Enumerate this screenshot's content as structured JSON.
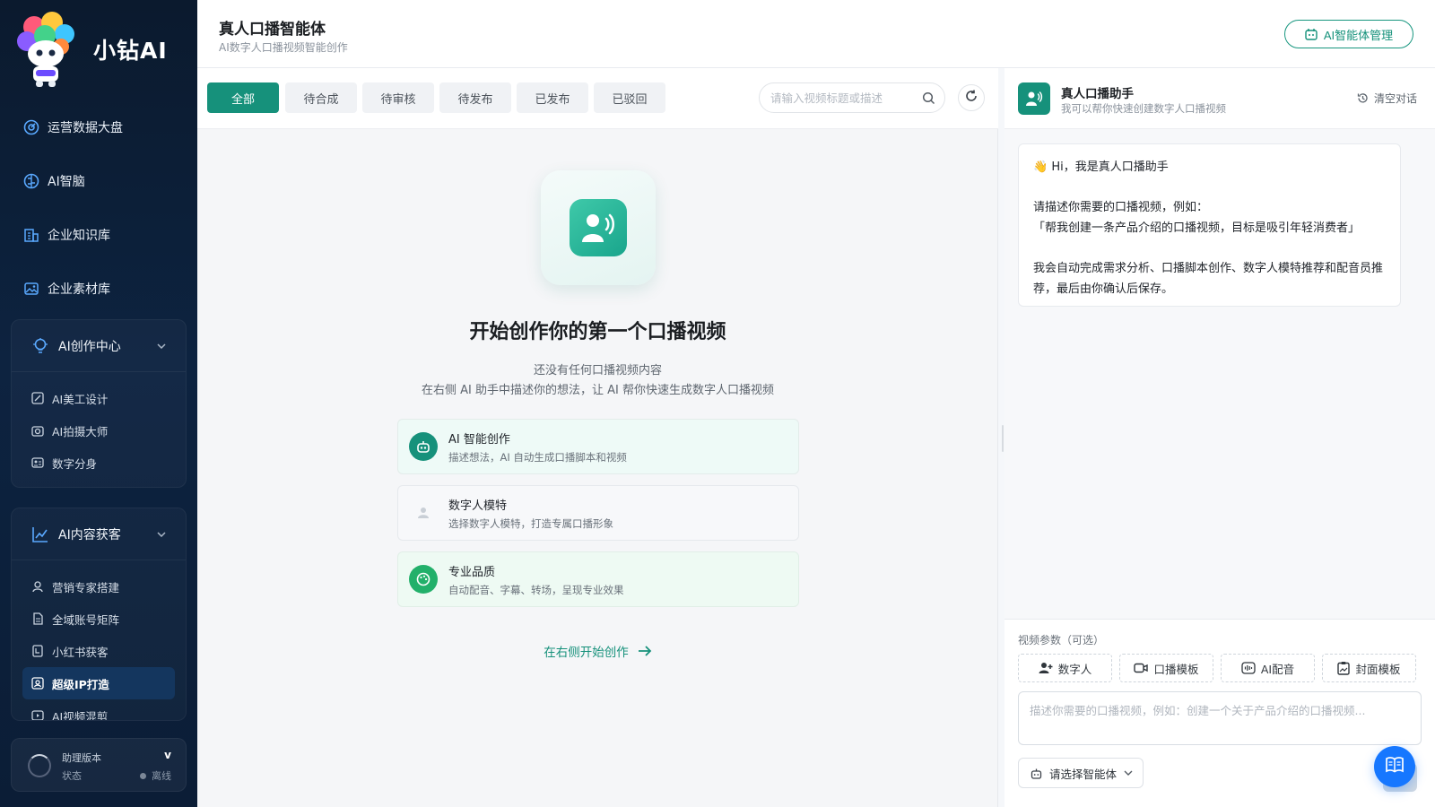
{
  "brand": {
    "name": "小钻AI",
    "mascot_badge": "小钻AI"
  },
  "nav_top": [
    {
      "label": "运营数据大盘",
      "icon": "dashboard-icon"
    },
    {
      "label": "AI智脑",
      "icon": "brain-icon"
    },
    {
      "label": "企业知识库",
      "icon": "building-icon"
    },
    {
      "label": "企业素材库",
      "icon": "image-icon"
    }
  ],
  "group_creation": {
    "label": "AI创作中心",
    "items": [
      {
        "label": "AI美工设计",
        "icon": "design-icon"
      },
      {
        "label": "AI拍摄大师",
        "icon": "camera-icon"
      },
      {
        "label": "数字分身",
        "icon": "id-card-icon"
      }
    ]
  },
  "group_content": {
    "label": "AI内容获客",
    "items": [
      {
        "label": "营销专家搭建",
        "icon": "user-icon"
      },
      {
        "label": "全域账号矩阵",
        "icon": "file-icon"
      },
      {
        "label": "小红书获客",
        "icon": "note-icon"
      },
      {
        "label": "超级IP打造",
        "icon": "ip-icon"
      },
      {
        "label": "AI视频混剪",
        "icon": "video-icon"
      }
    ]
  },
  "status": {
    "version_label": "助理版本",
    "version_value": "v",
    "state_label": "状态",
    "state_value": "离线"
  },
  "header": {
    "title": "真人口播智能体",
    "subtitle": "AI数字人口播视频智能创作",
    "manage_button": "AI智能体管理"
  },
  "tabs": [
    "全部",
    "待合成",
    "待审核",
    "待发布",
    "已发布",
    "已驳回"
  ],
  "search": {
    "placeholder": "请输入视频标题或描述"
  },
  "empty": {
    "title": "开始创作你的第一个口播视频",
    "line1": "还没有任何口播视频内容",
    "line2": "在右侧 AI 助手中描述你的想法，让 AI 帮你快速生成数字人口播视频"
  },
  "features": [
    {
      "title": "AI 智能创作",
      "desc": "描述想法，AI 自动生成口播脚本和视频",
      "icon": "robot-icon",
      "color": "#16917b"
    },
    {
      "title": "数字人模特",
      "desc": "选择数字人模特，打造专属口播形象",
      "icon": "person-icon",
      "color": "#c9cfd6"
    },
    {
      "title": "专业品质",
      "desc": "自动配音、字幕、转场，呈现专业效果",
      "icon": "palette-icon",
      "color": "#22b06a"
    }
  ],
  "start_link": "在右侧开始创作",
  "assistant": {
    "name": "真人口播助手",
    "desc": "我可以帮你快速创建数字人口播视频",
    "clear": "清空对话",
    "greeting": "👋 Hi，我是真人口播助手",
    "prompt_intro": "请描述你需要的口播视频，例如：",
    "example": "「帮我创建一条产品介绍的口播视频，目标是吸引年轻消费者」",
    "closing": "我会自动完成需求分析、口播脚本创作、数字人模特推荐和配音员推荐，最后由你确认后保存。"
  },
  "params": {
    "label": "视频参数（可选）",
    "buttons": [
      "数字人",
      "口播模板",
      "AI配音",
      "封面模板"
    ],
    "input_placeholder": "描述你需要的口播视频，例如：创建一个关于产品介绍的口播视频...",
    "agent_select": "请选择智能体"
  },
  "colors": {
    "accent": "#16917b",
    "sidebar": "#0b1a2e",
    "fab": "#1677ff"
  }
}
